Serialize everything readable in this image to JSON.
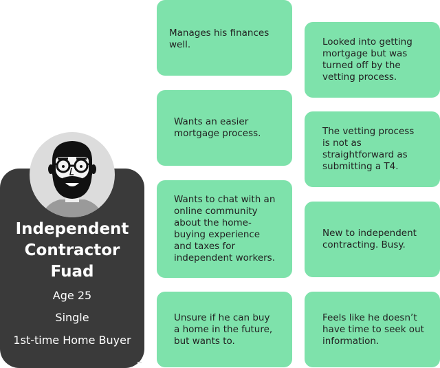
{
  "persona": {
    "title_lines": [
      "Independent",
      "Contractor",
      "Fuad"
    ],
    "age": "Age 25",
    "status": "Single",
    "buyer_type": "1st-time Home Buyer",
    "avatar_icon": "bearded-man-glasses-avatar"
  },
  "notes": {
    "finances": "Manages his finances well.",
    "easier_process": "Wants an easier mortgage process.",
    "community": "Wants to chat with an online community about the home-buying experience and taxes for independent workers.",
    "unsure": "Unsure if he can buy a home in the future, but wants to.",
    "mortgage_vetting": "Looked into getting mortgage but was turned off by the vetting process.",
    "vetting_t4": "The vetting process is not as straightforward as submitting a T4.",
    "new_contracting": "New to independent contracting. Busy.",
    "no_time": "Feels like he doesn’t have time to seek out information."
  },
  "colors": {
    "note_bg": "#7ee2ab",
    "card_bg": "#3a3a3a",
    "avatar_bg": "#dcdcdc"
  }
}
